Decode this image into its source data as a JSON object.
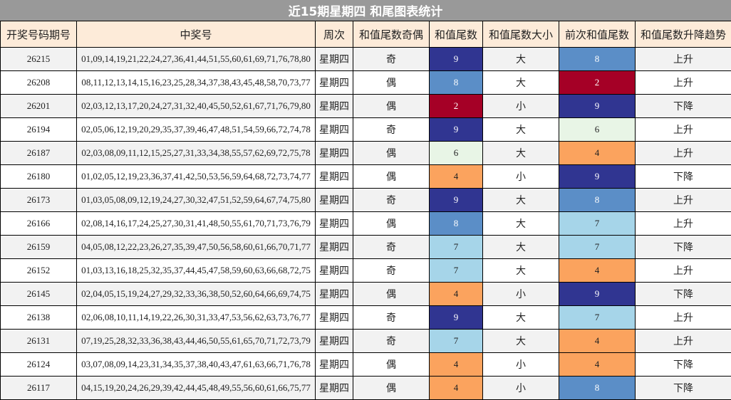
{
  "title": "近15期星期四 和尾图表统计",
  "headers": [
    "开奖号码期号",
    "中奖号",
    "周次",
    "和值尾数奇偶",
    "和值尾数",
    "和值尾数大小",
    "前次和值尾数",
    "和值尾数升降趋势"
  ],
  "tail_colors": {
    "2": "#a50026",
    "4": "#fba35e",
    "6": "#e8f5e6",
    "7": "#a6d5e9",
    "8": "#5b8ec7",
    "9": "#303591"
  },
  "rows": [
    {
      "issue": "26215",
      "numbers": "01,09,14,19,21,22,24,27,36,41,44,51,55,60,61,69,71,76,78,80",
      "weekday": "星期四",
      "parity": "奇",
      "tail": "9",
      "size": "大",
      "prev_tail": "8",
      "trend": "上升"
    },
    {
      "issue": "26208",
      "numbers": "08,11,12,13,14,15,16,23,25,28,34,37,38,43,45,48,58,70,73,77",
      "weekday": "星期四",
      "parity": "偶",
      "tail": "8",
      "size": "大",
      "prev_tail": "2",
      "trend": "上升"
    },
    {
      "issue": "26201",
      "numbers": "02,03,12,13,17,20,24,27,31,32,40,45,50,52,61,67,71,76,79,80",
      "weekday": "星期四",
      "parity": "偶",
      "tail": "2",
      "size": "小",
      "prev_tail": "9",
      "trend": "下降"
    },
    {
      "issue": "26194",
      "numbers": "02,05,06,12,19,20,29,35,37,39,46,47,48,51,54,59,66,72,74,78",
      "weekday": "星期四",
      "parity": "奇",
      "tail": "9",
      "size": "大",
      "prev_tail": "6",
      "trend": "上升"
    },
    {
      "issue": "26187",
      "numbers": "02,03,08,09,11,12,15,25,27,31,33,34,38,55,57,62,69,72,75,78",
      "weekday": "星期四",
      "parity": "偶",
      "tail": "6",
      "size": "大",
      "prev_tail": "4",
      "trend": "上升"
    },
    {
      "issue": "26180",
      "numbers": "01,02,05,12,19,23,36,37,41,42,50,53,56,59,64,68,72,73,74,77",
      "weekday": "星期四",
      "parity": "偶",
      "tail": "4",
      "size": "小",
      "prev_tail": "9",
      "trend": "下降"
    },
    {
      "issue": "26173",
      "numbers": "01,03,05,08,09,12,19,24,27,30,32,47,51,52,59,64,67,74,75,80",
      "weekday": "星期四",
      "parity": "奇",
      "tail": "9",
      "size": "大",
      "prev_tail": "8",
      "trend": "上升"
    },
    {
      "issue": "26166",
      "numbers": "02,08,14,16,17,24,25,27,30,31,41,48,50,55,61,70,71,73,76,79",
      "weekday": "星期四",
      "parity": "偶",
      "tail": "8",
      "size": "大",
      "prev_tail": "7",
      "trend": "上升"
    },
    {
      "issue": "26159",
      "numbers": "04,05,08,12,22,23,26,27,35,39,47,50,56,58,60,61,66,70,71,77",
      "weekday": "星期四",
      "parity": "奇",
      "tail": "7",
      "size": "大",
      "prev_tail": "7",
      "trend": "下降"
    },
    {
      "issue": "26152",
      "numbers": "01,03,13,16,18,25,32,35,37,44,45,47,58,59,60,63,66,68,72,75",
      "weekday": "星期四",
      "parity": "奇",
      "tail": "7",
      "size": "大",
      "prev_tail": "4",
      "trend": "上升"
    },
    {
      "issue": "26145",
      "numbers": "02,04,05,15,19,24,27,29,32,33,36,38,50,52,60,64,66,69,74,75",
      "weekday": "星期四",
      "parity": "偶",
      "tail": "4",
      "size": "小",
      "prev_tail": "9",
      "trend": "下降"
    },
    {
      "issue": "26138",
      "numbers": "02,06,08,10,11,14,19,22,26,30,31,33,47,53,56,62,63,73,76,77",
      "weekday": "星期四",
      "parity": "奇",
      "tail": "9",
      "size": "大",
      "prev_tail": "7",
      "trend": "上升"
    },
    {
      "issue": "26131",
      "numbers": "07,19,25,28,32,33,36,38,43,44,46,50,55,61,65,70,71,72,73,79",
      "weekday": "星期四",
      "parity": "奇",
      "tail": "7",
      "size": "大",
      "prev_tail": "4",
      "trend": "上升"
    },
    {
      "issue": "26124",
      "numbers": "03,07,08,09,14,23,31,34,35,37,38,40,43,47,61,63,66,71,76,78",
      "weekday": "星期四",
      "parity": "偶",
      "tail": "4",
      "size": "小",
      "prev_tail": "4",
      "trend": "下降"
    },
    {
      "issue": "26117",
      "numbers": "04,15,19,20,24,26,29,39,42,44,45,48,49,55,56,60,61,66,75,77",
      "weekday": "星期四",
      "parity": "偶",
      "tail": "4",
      "size": "小",
      "prev_tail": "8",
      "trend": "下降"
    }
  ]
}
